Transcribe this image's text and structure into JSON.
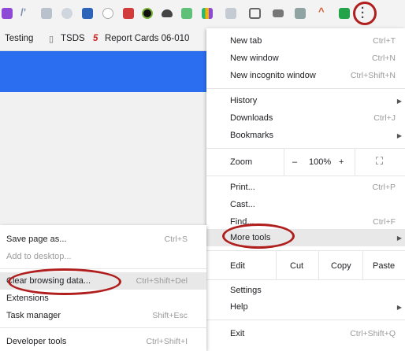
{
  "bookmarks": [
    "Testing",
    "TSDS",
    "Report Cards 06-010"
  ],
  "main_menu": {
    "new_tab": {
      "label": "New tab",
      "shortcut": "Ctrl+T"
    },
    "new_window": {
      "label": "New window",
      "shortcut": "Ctrl+N"
    },
    "new_incognito": {
      "label": "New incognito window",
      "shortcut": "Ctrl+Shift+N"
    },
    "history": {
      "label": "History"
    },
    "downloads": {
      "label": "Downloads",
      "shortcut": "Ctrl+J"
    },
    "bookmarks": {
      "label": "Bookmarks"
    },
    "zoom": {
      "label": "Zoom",
      "minus": "–",
      "value": "100%",
      "plus": "+"
    },
    "print": {
      "label": "Print...",
      "shortcut": "Ctrl+P"
    },
    "cast": {
      "label": "Cast..."
    },
    "find": {
      "label": "Find...",
      "shortcut": "Ctrl+F"
    },
    "more_tools": {
      "label": "More tools"
    },
    "edit": {
      "label": "Edit",
      "cut": "Cut",
      "copy": "Copy",
      "paste": "Paste"
    },
    "settings": {
      "label": "Settings"
    },
    "help": {
      "label": "Help"
    },
    "exit": {
      "label": "Exit",
      "shortcut": "Ctrl+Shift+Q"
    }
  },
  "sub_menu": {
    "save_page": {
      "label": "Save page as...",
      "shortcut": "Ctrl+S"
    },
    "add_desktop": {
      "label": "Add to desktop..."
    },
    "clear_data": {
      "label": "Clear browsing data...",
      "shortcut": "Ctrl+Shift+Del"
    },
    "extensions": {
      "label": "Extensions"
    },
    "task_manager": {
      "label": "Task manager",
      "shortcut": "Shift+Esc"
    },
    "dev_tools": {
      "label": "Developer tools",
      "shortcut": "Ctrl+Shift+I"
    }
  },
  "colors": {
    "accent_blue": "#2c6ef0",
    "annotation_red": "#b01e1e"
  }
}
